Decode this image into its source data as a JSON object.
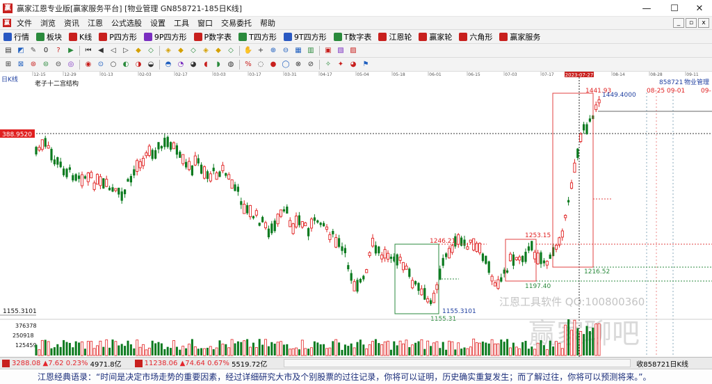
{
  "window": {
    "title": "赢家江恩专业版[赢家服务平台]  [物业管理  GN858721-185日K线]",
    "controls": [
      "—",
      "☐",
      "✕"
    ]
  },
  "menu": [
    "文件",
    "浏览",
    "资讯",
    "江恩",
    "公式选股",
    "设置",
    "工具",
    "窗口",
    "交易委托",
    "帮助"
  ],
  "mdi_controls": [
    "_",
    "▫",
    "x"
  ],
  "toolbar1": [
    {
      "label": "行情",
      "color": "#2a59c2"
    },
    {
      "label": "板块",
      "color": "#2a8a3c"
    },
    {
      "label": "K线",
      "color": "#c8201e"
    },
    {
      "label": "P四方形",
      "color": "#c8201e"
    },
    {
      "label": "9P四方形",
      "color": "#7a2ec0"
    },
    {
      "label": "P数字表",
      "color": "#c8201e"
    },
    {
      "label": "T四方形",
      "color": "#2a8a3c"
    },
    {
      "label": "9T四方形",
      "color": "#2a59c2"
    },
    {
      "label": "T数字表",
      "color": "#2a8a3c"
    },
    {
      "label": "江恩轮",
      "color": "#c8201e"
    },
    {
      "label": "赢家轮",
      "color": "#c8201e"
    },
    {
      "label": "六角形",
      "color": "#c8201e"
    },
    {
      "label": "赢家服务",
      "color": "#c8201e"
    }
  ],
  "toolbar2_icons": [
    "period-icon",
    "chart-type-icon",
    "cursor-icon",
    "zero-icon",
    "query-icon",
    "arrow-flag-icon",
    "first-icon",
    "prev-icon",
    "left-icon",
    "right-icon",
    "diamond-icon",
    "diamond2-icon",
    "diamond3-icon",
    "diamond4-icon",
    "diamond5-icon",
    "diamond6-icon",
    "diamond7-icon",
    "diamond8-icon",
    "hand-icon",
    "crosshair-icon",
    "zoom-in-icon",
    "zoom-out-icon",
    "table-icon",
    "chart1-icon",
    "chart2-icon",
    "chart3-icon",
    "chart4-icon"
  ],
  "toolbar3_icons": [
    "circle-a-icon",
    "circle-b-icon",
    "circle-c-icon",
    "circle-d-icon",
    "circle-e-icon",
    "circle-f-icon",
    "circle-g-icon",
    "circle-h-icon",
    "circle-i-icon",
    "circle-j-icon",
    "circle-k-icon",
    "circle-l-icon",
    "circle-m-icon",
    "circle-n-icon",
    "circle-o-icon",
    "circle-p-icon",
    "circle-q-icon",
    "circle-r-icon",
    "circle-s-icon",
    "circle-t-icon",
    "circle-u-icon",
    "circle-v-icon",
    "circle-w-icon",
    "circle-x-icon",
    "circle-y-icon",
    "circle-z-icon",
    "pie-icon",
    "flag-icon"
  ],
  "chart": {
    "period_label": "日K线",
    "indicator_name": "老子十二宫结构",
    "stock_code": "858721",
    "stock_name": "物业管理",
    "cursor_date": "2023-07-27",
    "price_tag": "388.9520",
    "dates": [
      "12-15",
      "12-29",
      "01-13",
      "02-03",
      "02-17",
      "03-03",
      "03-17",
      "03-31",
      "04-17",
      "05-04",
      "05-18",
      "06-01",
      "06-15",
      "07-03",
      "07-17",
      "08-14",
      "08-28",
      "09-11"
    ],
    "annotations": {
      "high_label": "1441.93",
      "high_ref": "1449.4000",
      "date_label": "08-25 09-01",
      "date_label2": "09-",
      "box1_top": "1246.21",
      "box1_low": "1155.3101",
      "box1_low2": "1155.31",
      "box2_top": "1253.15",
      "box2_low": "1197.40",
      "box3_low": "1216.52",
      "left_low": "1155.3101"
    },
    "volume_scale": [
      "376378",
      "250918",
      "125459"
    ],
    "watermark": [
      "江恩工具软件 QQ:100800360",
      "赢家聊吧"
    ]
  },
  "status": {
    "sh": {
      "value": "3288.08",
      "change": "▲7.62",
      "pct": "0.23%",
      "amount": "4971.8亿"
    },
    "sz": {
      "value": "11238.06",
      "change": "▲74.64",
      "pct": "0.67%",
      "amount": "5519.72亿"
    },
    "right": "收858721日K线"
  },
  "quote": "江恩经典语录：“时间是决定市场走势的重要因素，经过详细研究大市及个别股票的过往记录，你将可以证明，历史确实重复发生；而了解过往，你将可以预测将来。”。"
}
